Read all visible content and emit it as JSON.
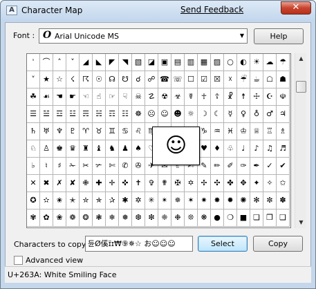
{
  "window": {
    "title": "Character Map",
    "send_feedback": "Send Feedback",
    "close_glyph": "✕"
  },
  "font": {
    "label": "Font :",
    "selected": "Arial Unicode MS",
    "help_label": "Help"
  },
  "grid": {
    "rows": [
      [
        "ˈ",
        "⌒",
        "˄",
        "˅",
        "◢",
        "◣",
        "◤",
        "◥",
        "▧",
        "◪",
        "▣",
        "▤",
        "▥",
        "▦",
        "▨",
        "○",
        "◐",
        "☀",
        "☁",
        "☂"
      ],
      [
        "˅",
        "★",
        "☆",
        "☇",
        "☈",
        "☉",
        "☊",
        "☋",
        "☌",
        "☍",
        "☎",
        "☏",
        "☐",
        "☑",
        "☒",
        "☓",
        "☔",
        "☕",
        "☖",
        "☗"
      ],
      [
        "☘",
        "☙",
        "☚",
        "☛",
        "☜",
        "☝",
        "☞",
        "☟",
        "☠",
        "☡",
        "☢",
        "☣",
        "☤",
        "☥",
        "☦",
        "☧",
        "☨",
        "☩",
        "☪",
        "☫"
      ],
      [
        "☰",
        "☱",
        "☲",
        "☳",
        "☴",
        "☵",
        "☶",
        "☷",
        "☸",
        "☹",
        "☺",
        "☻",
        "☼",
        "☽",
        "☾",
        "☿",
        "♀",
        "♁",
        "♂",
        "♃"
      ],
      [
        "♄",
        "♅",
        "♆",
        "♇",
        "♈",
        "♉",
        "♊",
        "♋",
        "♌",
        "♍",
        "♎",
        "♏",
        "♐",
        "♑",
        "♒",
        "♓",
        "♔",
        "♕",
        "♖",
        "♗"
      ],
      [
        "♘",
        "♙",
        "♚",
        "♛",
        "♜",
        "♝",
        "♞",
        "♟",
        "♠",
        "♡",
        "♢",
        "♣",
        "♤",
        "♥",
        "♦",
        "♧",
        "♩",
        "♪",
        "♫",
        "♬"
      ],
      [
        "♭",
        "♮",
        "♯",
        "✁",
        "✂",
        "✃",
        "✄",
        "✆",
        "✇",
        "✈",
        "✉",
        "✌",
        "✍",
        "✎",
        "✏",
        "✐",
        "✑",
        "✒",
        "✓",
        "✔"
      ],
      [
        "✕",
        "✖",
        "✗",
        "✘",
        "✙",
        "✚",
        "✛",
        "✜",
        "✝",
        "✞",
        "✟",
        "✠",
        "✡",
        "✢",
        "✣",
        "✤",
        "✥",
        "✦",
        "✧",
        "✩"
      ],
      [
        "✪",
        "✫",
        "✬",
        "✭",
        "✮",
        "✯",
        "✰",
        "✱",
        "✲",
        "✳",
        "✴",
        "✵",
        "✶",
        "✷",
        "✸",
        "✹",
        "✺",
        "✻",
        "✼",
        "✽"
      ],
      [
        "✾",
        "✿",
        "❀",
        "❁",
        "❂",
        "❃",
        "❄",
        "❅",
        "❆",
        "❇",
        "❈",
        "❉",
        "❊",
        "❋",
        "●",
        "❍",
        "■",
        "❏",
        "❐",
        "❑"
      ]
    ],
    "zoom_char": "☺"
  },
  "copy": {
    "label": "Characters to copy",
    "value": "듄Ø傒ɪ̈ɪ₩⑨✵☆ お☺☺☺",
    "select_label": "Select",
    "copy_label": "Copy"
  },
  "advanced": {
    "label": "Advanced view"
  },
  "status": {
    "text": "U+263A: White Smiling Face"
  }
}
